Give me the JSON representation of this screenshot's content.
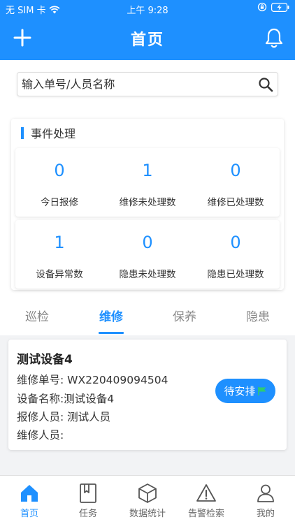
{
  "status_bar": {
    "carrier": "无 SIM 卡",
    "time": "上午 9:28"
  },
  "nav": {
    "title": "首页",
    "add_icon": "plus-icon",
    "bell_icon": "bell-icon"
  },
  "search": {
    "placeholder": "输入单号/人员名称",
    "value": ""
  },
  "events": {
    "title": "事件处理",
    "stats": [
      {
        "value": "0",
        "label": "今日报修"
      },
      {
        "value": "1",
        "label": "维修未处理数"
      },
      {
        "value": "0",
        "label": "维修已处理数"
      },
      {
        "value": "1",
        "label": "设备异常数"
      },
      {
        "value": "0",
        "label": "隐患未处理数"
      },
      {
        "value": "0",
        "label": "隐患已处理数"
      }
    ]
  },
  "tabs": [
    {
      "label": "巡检",
      "active": false
    },
    {
      "label": "维修",
      "active": true
    },
    {
      "label": "保养",
      "active": false
    },
    {
      "label": "隐患",
      "active": false
    }
  ],
  "repair_card": {
    "title": "测试设备4",
    "order_no": "维修单号: WX220409094504",
    "device_name": "设备名称:测试设备4",
    "reporter": "报修人员: 测试人员",
    "repairer": "维修人员:",
    "status": "待安排",
    "status_icon": "flag-icon"
  },
  "tabbar": [
    {
      "label": "首页",
      "icon": "home-icon",
      "active": true
    },
    {
      "label": "任务",
      "icon": "task-icon",
      "active": false
    },
    {
      "label": "数据统计",
      "icon": "cube-icon",
      "active": false
    },
    {
      "label": "告警检索",
      "icon": "warning-icon",
      "active": false
    },
    {
      "label": "我的",
      "icon": "user-icon",
      "active": false
    }
  ],
  "colors": {
    "primary": "#1e90ff",
    "flag": "#2ecc71",
    "text": "#333333",
    "muted": "#888888"
  }
}
